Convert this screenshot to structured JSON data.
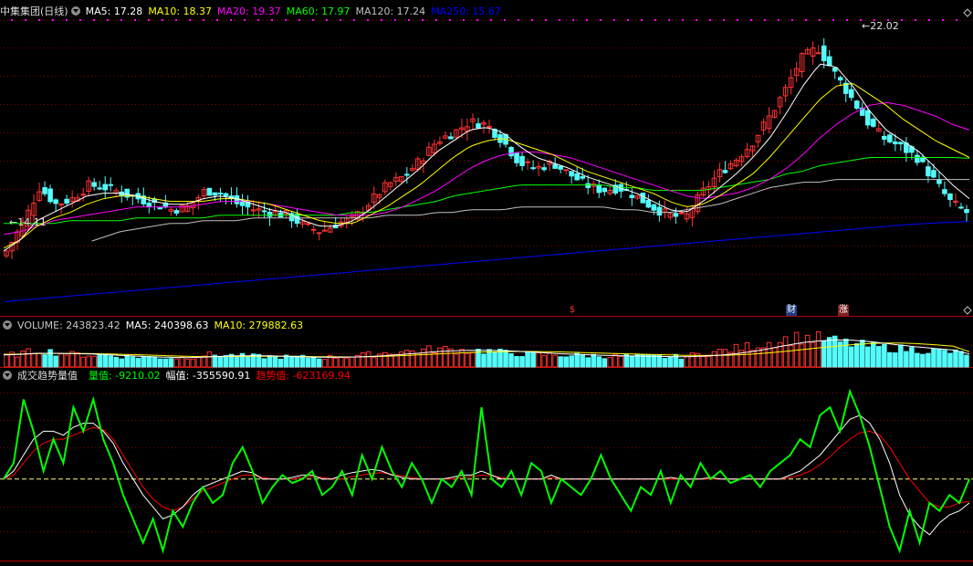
{
  "colors": {
    "up": "#ff3232",
    "down": "#54fcfc",
    "ma5": "#ffffff",
    "ma10": "#ffff00",
    "ma20": "#ff00ff",
    "ma60": "#00ff00",
    "ma120": "#c0c0c0",
    "ma250": "#0000ff",
    "grid": "#800000",
    "vol": "#ffffff",
    "trend": "#ff0000",
    "amp": "#ffffff",
    "zero": "#ffff80",
    "qty": "#00ff00"
  },
  "icons": [
    "chevron-down-circle-icon"
  ],
  "price_header": {
    "title": "中集集团(日线)",
    "items": [
      {
        "text": "MA5: 17.28",
        "color": "#ffffff"
      },
      {
        "text": "MA10: 18.37",
        "color": "#ffff00"
      },
      {
        "text": "MA20: 19.37",
        "color": "#ff00ff"
      },
      {
        "text": "MA60: 17.97",
        "color": "#00ff00"
      },
      {
        "text": "MA120: 17.24",
        "color": "#c0c0c0"
      },
      {
        "text": "MA250: 15.67",
        "color": "#0000ff"
      }
    ]
  },
  "volume_header": {
    "items": [
      {
        "text": "VOLUME: 243823.42",
        "color": "#c8c8c8"
      },
      {
        "text": "MA5: 240398.63",
        "color": "#ffffff"
      },
      {
        "text": "MA10: 279882.63",
        "color": "#ffff00"
      }
    ]
  },
  "indicator_header": {
    "title": "成交趋势量值",
    "items": [
      {
        "text": "量值: -9210.02",
        "color": "#00ff00"
      },
      {
        "text": "幅值: -355590.91",
        "color": "#ffffff"
      },
      {
        "text": "趋势值: -623169.94",
        "color": "#ff0000"
      }
    ]
  },
  "annotations": {
    "high": "22.02",
    "low": "14.11",
    "events": [
      {
        "text": "$",
        "color": "#ff3232",
        "bg": "#000000",
        "pos": 0.585
      },
      {
        "text": "财",
        "color": "#ffffff",
        "bg": "#203a80",
        "pos": 0.81
      },
      {
        "text": "涨",
        "color": "#ffffff",
        "bg": "#802020",
        "pos": 0.864
      }
    ]
  },
  "chart_data": [
    {
      "type": "candlestick",
      "title": "中集集团(日线)",
      "ylim": [
        12.7,
        23.0
      ],
      "high": 22.02,
      "low": 14.11,
      "count": 176,
      "close_path": [
        14.6,
        15.6,
        16.9,
        16.3,
        16.5,
        17.0,
        16.9,
        16.7,
        16.5,
        16.3,
        16.1,
        16.2,
        16.8,
        16.7,
        16.3,
        16.1,
        16.0,
        15.9,
        15.5,
        15.3,
        15.6,
        15.8,
        16.4,
        17.0,
        17.3,
        17.9,
        18.6,
        18.9,
        19.3,
        19.2,
        18.6,
        17.8,
        17.6,
        17.8,
        17.4,
        17.0,
        16.8,
        16.9,
        16.6,
        16.2,
        15.9,
        15.8,
        16.7,
        17.4,
        17.9,
        18.5,
        19.4,
        20.4,
        21.6,
        22.0,
        21.1,
        20.2,
        19.3,
        18.7,
        18.4,
        18.0,
        17.2,
        16.4,
        16.0
      ],
      "ma5": [
        14.6,
        15.0,
        15.7,
        16.0,
        16.3,
        16.6,
        16.7,
        16.7,
        16.6,
        16.4,
        16.3,
        16.3,
        16.5,
        16.6,
        16.5,
        16.3,
        16.1,
        16.0,
        15.7,
        15.5,
        15.5,
        15.7,
        16.1,
        16.6,
        17.1,
        17.6,
        18.2,
        18.6,
        19.0,
        19.1,
        18.9,
        18.4,
        18.0,
        17.8,
        17.6,
        17.3,
        17.1,
        16.9,
        16.7,
        16.4,
        16.1,
        16.0,
        16.4,
        16.9,
        17.4,
        18.0,
        18.7,
        19.6,
        20.6,
        21.4,
        21.3,
        20.6,
        19.7,
        19.0,
        18.6,
        18.2,
        17.6,
        17.0,
        16.5
      ],
      "ma10": [
        14.7,
        15.0,
        15.5,
        15.8,
        16.0,
        16.3,
        16.5,
        16.6,
        16.6,
        16.5,
        16.4,
        16.4,
        16.4,
        16.5,
        16.5,
        16.4,
        16.3,
        16.1,
        15.9,
        15.7,
        15.6,
        15.6,
        15.9,
        16.2,
        16.6,
        17.0,
        17.5,
        18.0,
        18.4,
        18.6,
        18.7,
        18.5,
        18.3,
        18.1,
        17.8,
        17.5,
        17.3,
        17.1,
        16.9,
        16.7,
        16.4,
        16.2,
        16.3,
        16.6,
        17.0,
        17.4,
        18.0,
        18.7,
        19.4,
        20.1,
        20.6,
        20.7,
        20.3,
        19.9,
        19.4,
        19.0,
        18.6,
        18.3,
        18.0
      ],
      "ma20": [
        15.2,
        15.3,
        15.5,
        15.7,
        15.8,
        15.9,
        16.0,
        16.1,
        16.2,
        16.2,
        16.2,
        16.2,
        16.3,
        16.4,
        16.4,
        16.4,
        16.3,
        16.2,
        16.1,
        16.0,
        15.9,
        15.9,
        15.9,
        16.0,
        16.2,
        16.5,
        16.8,
        17.2,
        17.6,
        17.9,
        18.1,
        18.2,
        18.2,
        18.1,
        18.0,
        17.8,
        17.6,
        17.4,
        17.2,
        17.0,
        16.8,
        16.6,
        16.5,
        16.6,
        16.7,
        16.9,
        17.2,
        17.6,
        18.1,
        18.7,
        19.2,
        19.6,
        19.9,
        20.0,
        19.9,
        19.7,
        19.5,
        19.2,
        19.0
      ],
      "ma60": [
        15.6,
        15.6,
        15.6,
        15.6,
        15.7,
        15.7,
        15.7,
        15.7,
        15.8,
        15.8,
        15.8,
        15.8,
        15.8,
        15.9,
        15.9,
        15.9,
        15.9,
        15.9,
        15.9,
        15.9,
        15.9,
        16.0,
        16.0,
        16.1,
        16.2,
        16.3,
        16.4,
        16.6,
        16.7,
        16.8,
        16.9,
        17.0,
        17.0,
        17.0,
        17.0,
        17.0,
        17.0,
        16.9,
        16.9,
        16.8,
        16.8,
        16.8,
        16.8,
        16.9,
        17.0,
        17.1,
        17.2,
        17.4,
        17.5,
        17.7,
        17.8,
        17.9,
        18.0,
        18.0,
        18.0,
        18.0,
        18.0,
        18.0,
        17.97
      ],
      "ma120": [
        null,
        null,
        null,
        null,
        null,
        14.9,
        15.1,
        15.3,
        15.4,
        15.5,
        15.6,
        15.6,
        15.7,
        15.7,
        15.7,
        15.8,
        15.8,
        15.8,
        15.8,
        15.8,
        15.8,
        15.8,
        15.8,
        15.9,
        15.9,
        15.9,
        16.0,
        16.0,
        16.1,
        16.1,
        16.1,
        16.2,
        16.2,
        16.2,
        16.2,
        16.2,
        16.2,
        16.1,
        16.1,
        16.0,
        16.0,
        16.1,
        16.2,
        16.3,
        16.5,
        16.7,
        16.9,
        17.0,
        17.1,
        17.1,
        17.2,
        17.2,
        17.2,
        17.2,
        17.2,
        17.2,
        17.2,
        17.2,
        17.2
      ],
      "ma250": [
        12.75,
        12.85,
        12.95,
        13.05,
        13.15,
        13.25,
        13.35,
        13.45,
        13.55,
        13.65,
        13.75,
        13.85,
        13.95,
        14.05,
        14.15,
        14.25,
        14.35,
        14.45,
        14.55,
        14.65,
        14.75,
        14.85,
        14.95,
        15.05,
        15.15,
        15.25,
        15.35,
        15.45,
        15.55,
        15.62,
        15.67
      ]
    },
    {
      "type": "bar",
      "title": "VOLUME",
      "ylim": [
        0,
        600000
      ],
      "values_path": [
        210000,
        250000,
        310000,
        260000,
        230000,
        220000,
        210000,
        190000,
        180000,
        170000,
        165000,
        175000,
        230000,
        215000,
        200000,
        190000,
        185000,
        180000,
        175000,
        170000,
        185000,
        200000,
        230000,
        260000,
        280000,
        300000,
        330000,
        310000,
        300000,
        290000,
        260000,
        240000,
        225000,
        220000,
        210000,
        205000,
        200000,
        195000,
        190000,
        185000,
        180000,
        190000,
        240000,
        280000,
        330000,
        380000,
        440000,
        500000,
        540000,
        520000,
        470000,
        420000,
        380000,
        350000,
        330000,
        310000,
        290000,
        270000,
        243823
      ],
      "ma5_path": [
        220000,
        230000,
        250000,
        250000,
        245000,
        240000,
        228000,
        212000,
        198000,
        186000,
        177000,
        172000,
        180000,
        192000,
        205000,
        206000,
        203000,
        194000,
        184000,
        178000,
        177000,
        182000,
        192000,
        208000,
        230000,
        254000,
        280000,
        296000,
        304000,
        306000,
        298000,
        284000,
        268000,
        249000,
        235000,
        224000,
        213000,
        206000,
        200000,
        195000,
        190000,
        188000,
        197000,
        214000,
        243000,
        284000,
        336000,
        394000,
        446000,
        476000,
        494000,
        488000,
        464000,
        430000,
        394000,
        362000,
        336000,
        310000,
        240398
      ],
      "ma10_path": [
        230000,
        235000,
        245000,
        248000,
        247000,
        245000,
        240000,
        232000,
        224000,
        215000,
        205000,
        195000,
        190000,
        190000,
        192000,
        194000,
        195000,
        196000,
        192000,
        188000,
        185000,
        183000,
        188000,
        196000,
        208000,
        222000,
        238000,
        252000,
        265000,
        274000,
        280000,
        284000,
        283000,
        278000,
        270000,
        262000,
        252000,
        244000,
        236000,
        228000,
        220000,
        212000,
        210000,
        212000,
        220000,
        236000,
        258000,
        286000,
        318000,
        350000,
        380000,
        408000,
        428000,
        438000,
        436000,
        424000,
        404000,
        382000,
        279883
      ]
    },
    {
      "type": "line",
      "title": "成交趋势量值",
      "ylim": [
        -1.0,
        1.2
      ],
      "zero": 0,
      "series": [
        {
          "name": "量值",
          "values": [
            0.0,
            0.2,
            1.0,
            0.6,
            0.1,
            0.5,
            0.2,
            0.9,
            0.6,
            1.0,
            0.5,
            0.2,
            -0.2,
            -0.5,
            -0.8,
            -0.5,
            -0.9,
            -0.4,
            -0.6,
            -0.3,
            -0.1,
            -0.3,
            -0.2,
            0.2,
            0.4,
            0.1,
            -0.3,
            -0.1,
            0.05,
            -0.05,
            0.0,
            0.1,
            -0.2,
            -0.1,
            0.1,
            -0.2,
            0.3,
            0.0,
            0.4,
            0.1,
            -0.1,
            0.2,
            0.0,
            -0.3,
            0.0,
            -0.1,
            0.1,
            -0.2,
            0.9,
            0.0,
            -0.1,
            0.1,
            -0.2,
            0.2,
            0.1,
            -0.3,
            0.0,
            -0.1,
            -0.2,
            0.0,
            0.3,
            0.0,
            -0.2,
            -0.4,
            -0.1,
            -0.2,
            0.1,
            -0.3,
            0.05,
            -0.1,
            0.2,
            0.0,
            0.1,
            -0.05,
            0.0,
            0.05,
            -0.1,
            0.1,
            0.2,
            0.3,
            0.5,
            0.4,
            0.8,
            0.9,
            0.6,
            1.1,
            0.8,
            0.4,
            -0.1,
            -0.6,
            -0.9,
            -0.4,
            -0.8,
            -0.3,
            -0.4,
            -0.2,
            -0.3,
            0.0
          ]
        },
        {
          "name": "幅值",
          "values": [
            0.0,
            0.1,
            0.3,
            0.5,
            0.6,
            0.6,
            0.55,
            0.65,
            0.7,
            0.7,
            0.6,
            0.45,
            0.2,
            0.0,
            -0.2,
            -0.35,
            -0.5,
            -0.45,
            -0.35,
            -0.2,
            -0.1,
            -0.05,
            0.0,
            0.05,
            0.1,
            0.08,
            0.0,
            0.0,
            0.0,
            0.02,
            0.05,
            0.05,
            0.0,
            0.0,
            0.05,
            0.08,
            0.1,
            0.12,
            0.1,
            0.05,
            0.02,
            0.0,
            0.0,
            0.0,
            0.0,
            0.02,
            0.05,
            0.05,
            0.1,
            0.05,
            0.0,
            0.0,
            0.0,
            0.0,
            0.0,
            0.05,
            0.0,
            0.0,
            0.0,
            0.0,
            0.0,
            0.0,
            0.0,
            0.0,
            0.0,
            0.0,
            0.0,
            0.02,
            0.0,
            0.0,
            0.0,
            0.02,
            0.0,
            0.0,
            0.0,
            0.0,
            0.0,
            0.0,
            0.0,
            0.05,
            0.1,
            0.2,
            0.3,
            0.45,
            0.6,
            0.75,
            0.8,
            0.7,
            0.5,
            0.2,
            -0.2,
            -0.45,
            -0.6,
            -0.7,
            -0.55,
            -0.45,
            -0.4,
            -0.3
          ]
        },
        {
          "name": "趋势值",
          "values": [
            0.0,
            0.05,
            0.2,
            0.35,
            0.45,
            0.5,
            0.5,
            0.55,
            0.6,
            0.65,
            0.62,
            0.5,
            0.3,
            0.1,
            -0.1,
            -0.25,
            -0.35,
            -0.4,
            -0.35,
            -0.25,
            -0.15,
            -0.1,
            -0.05,
            0.0,
            0.05,
            0.05,
            0.02,
            0.0,
            0.0,
            0.0,
            0.02,
            0.03,
            0.02,
            0.0,
            0.0,
            0.03,
            0.05,
            0.07,
            0.08,
            0.06,
            0.04,
            0.02,
            0.0,
            0.0,
            0.0,
            0.0,
            0.02,
            0.03,
            0.05,
            0.04,
            0.02,
            0.0,
            0.0,
            0.0,
            0.0,
            0.02,
            0.0,
            0.0,
            0.0,
            0.0,
            0.0,
            0.0,
            0.0,
            0.0,
            0.0,
            0.0,
            0.0,
            0.0,
            0.0,
            0.0,
            0.0,
            0.0,
            0.0,
            0.0,
            0.0,
            0.0,
            0.0,
            0.0,
            0.0,
            0.02,
            0.05,
            0.1,
            0.18,
            0.28,
            0.4,
            0.5,
            0.58,
            0.6,
            0.55,
            0.4,
            0.2,
            0.0,
            -0.15,
            -0.3,
            -0.35,
            -0.35,
            -0.3,
            -0.28
          ]
        }
      ]
    }
  ]
}
